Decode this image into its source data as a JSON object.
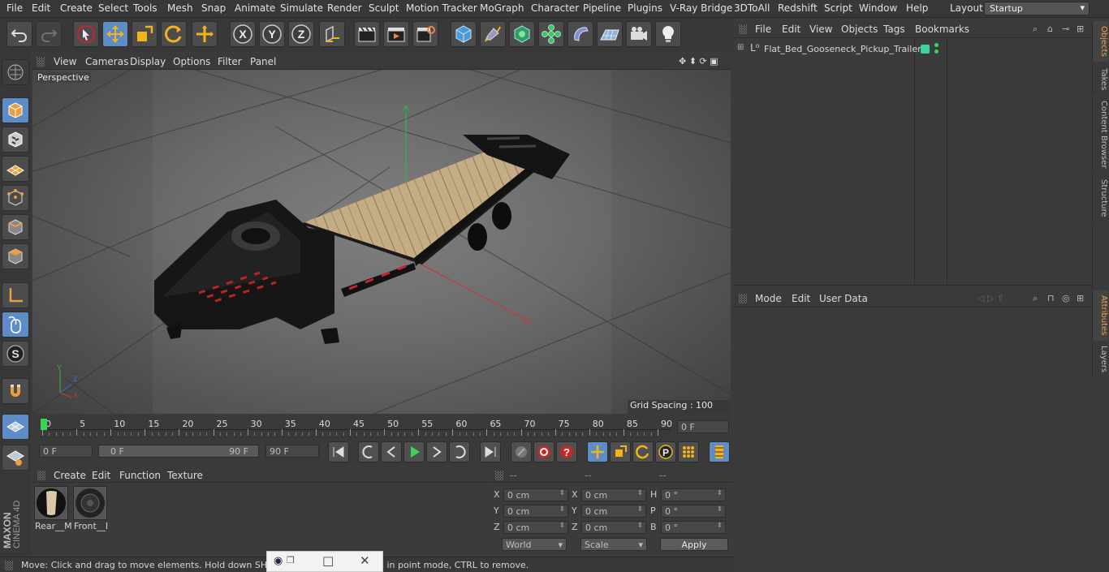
{
  "menu": [
    "File",
    "Edit",
    "Create",
    "Select",
    "Tools",
    "Mesh",
    "Snap",
    "Animate",
    "Simulate",
    "Render",
    "Sculpt",
    "Motion Tracker",
    "MoGraph",
    "Character",
    "Pipeline",
    "Plugins",
    "V-Ray Bridge",
    "3DToAll",
    "Redshift",
    "Script",
    "Window",
    "Help"
  ],
  "layout": {
    "label": "Layout:",
    "value": "Startup"
  },
  "viewport_menu": [
    "View",
    "Cameras",
    "Display",
    "Options",
    "Filter",
    "Panel"
  ],
  "viewport": {
    "camera_label": "Perspective",
    "grid_spacing": "Grid Spacing : 100 cm"
  },
  "timeline": {
    "ticks": [
      "0",
      "5",
      "10",
      "15",
      "20",
      "25",
      "30",
      "35",
      "40",
      "45",
      "50",
      "55",
      "60",
      "65",
      "70",
      "75",
      "80",
      "85",
      "90"
    ],
    "current_frame": "0 F"
  },
  "transport": {
    "start": "0 F",
    "range_start": "0 F",
    "range_end": "90 F",
    "end": "90 F"
  },
  "materials_menu": [
    "Create",
    "Edit",
    "Function",
    "Texture"
  ],
  "materials": [
    {
      "name": "Rear__M"
    },
    {
      "name": "Front__I"
    }
  ],
  "coords": {
    "headers": [
      "--",
      "--",
      "--"
    ],
    "rows": [
      {
        "a": "X",
        "av": "0 cm",
        "b": "X",
        "bv": "0 cm",
        "c": "H",
        "cv": "0 °"
      },
      {
        "a": "Y",
        "av": "0 cm",
        "b": "Y",
        "bv": "0 cm",
        "c": "P",
        "cv": "0 °"
      },
      {
        "a": "Z",
        "av": "0 cm",
        "b": "Z",
        "bv": "0 cm",
        "c": "B",
        "cv": "0 °"
      }
    ],
    "world": "World",
    "scale": "Scale",
    "apply": "Apply"
  },
  "objects_menu": [
    "File",
    "Edit",
    "View",
    "Objects",
    "Tags",
    "Bookmarks"
  ],
  "object_item": "Flat_Bed_Gooseneck_Pickup_Trailer",
  "attributes_menu": [
    "Mode",
    "Edit",
    "User Data"
  ],
  "right_tabs": [
    "Objects",
    "Takes",
    "Content Browser",
    "Structure"
  ],
  "right_tabs2": [
    "Attributes",
    "Layers"
  ],
  "status": "Move: Click and drag to move elements. Hold down SHIFT to add to the selection in point mode, CTRL to remove.",
  "brand": {
    "line1": "MAXON",
    "line2": "CINEMA 4D"
  },
  "colors": {
    "accent": "#5d8cc7",
    "x_axis": "#c43a3a",
    "y_axis": "#38b048",
    "wood": "#b8a078"
  }
}
